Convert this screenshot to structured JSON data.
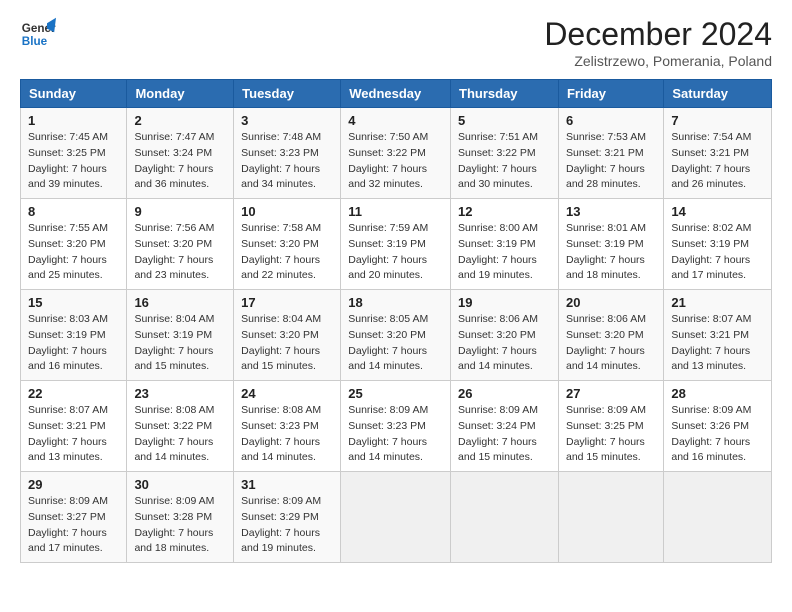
{
  "logo": {
    "line1": "General",
    "line2": "Blue"
  },
  "title": "December 2024",
  "location": "Zelistrzewo, Pomerania, Poland",
  "days_of_week": [
    "Sunday",
    "Monday",
    "Tuesday",
    "Wednesday",
    "Thursday",
    "Friday",
    "Saturday"
  ],
  "weeks": [
    [
      {
        "day": "1",
        "info": "Sunrise: 7:45 AM\nSunset: 3:25 PM\nDaylight: 7 hours\nand 39 minutes."
      },
      {
        "day": "2",
        "info": "Sunrise: 7:47 AM\nSunset: 3:24 PM\nDaylight: 7 hours\nand 36 minutes."
      },
      {
        "day": "3",
        "info": "Sunrise: 7:48 AM\nSunset: 3:23 PM\nDaylight: 7 hours\nand 34 minutes."
      },
      {
        "day": "4",
        "info": "Sunrise: 7:50 AM\nSunset: 3:22 PM\nDaylight: 7 hours\nand 32 minutes."
      },
      {
        "day": "5",
        "info": "Sunrise: 7:51 AM\nSunset: 3:22 PM\nDaylight: 7 hours\nand 30 minutes."
      },
      {
        "day": "6",
        "info": "Sunrise: 7:53 AM\nSunset: 3:21 PM\nDaylight: 7 hours\nand 28 minutes."
      },
      {
        "day": "7",
        "info": "Sunrise: 7:54 AM\nSunset: 3:21 PM\nDaylight: 7 hours\nand 26 minutes."
      }
    ],
    [
      {
        "day": "8",
        "info": "Sunrise: 7:55 AM\nSunset: 3:20 PM\nDaylight: 7 hours\nand 25 minutes."
      },
      {
        "day": "9",
        "info": "Sunrise: 7:56 AM\nSunset: 3:20 PM\nDaylight: 7 hours\nand 23 minutes."
      },
      {
        "day": "10",
        "info": "Sunrise: 7:58 AM\nSunset: 3:20 PM\nDaylight: 7 hours\nand 22 minutes."
      },
      {
        "day": "11",
        "info": "Sunrise: 7:59 AM\nSunset: 3:19 PM\nDaylight: 7 hours\nand 20 minutes."
      },
      {
        "day": "12",
        "info": "Sunrise: 8:00 AM\nSunset: 3:19 PM\nDaylight: 7 hours\nand 19 minutes."
      },
      {
        "day": "13",
        "info": "Sunrise: 8:01 AM\nSunset: 3:19 PM\nDaylight: 7 hours\nand 18 minutes."
      },
      {
        "day": "14",
        "info": "Sunrise: 8:02 AM\nSunset: 3:19 PM\nDaylight: 7 hours\nand 17 minutes."
      }
    ],
    [
      {
        "day": "15",
        "info": "Sunrise: 8:03 AM\nSunset: 3:19 PM\nDaylight: 7 hours\nand 16 minutes."
      },
      {
        "day": "16",
        "info": "Sunrise: 8:04 AM\nSunset: 3:19 PM\nDaylight: 7 hours\nand 15 minutes."
      },
      {
        "day": "17",
        "info": "Sunrise: 8:04 AM\nSunset: 3:20 PM\nDaylight: 7 hours\nand 15 minutes."
      },
      {
        "day": "18",
        "info": "Sunrise: 8:05 AM\nSunset: 3:20 PM\nDaylight: 7 hours\nand 14 minutes."
      },
      {
        "day": "19",
        "info": "Sunrise: 8:06 AM\nSunset: 3:20 PM\nDaylight: 7 hours\nand 14 minutes."
      },
      {
        "day": "20",
        "info": "Sunrise: 8:06 AM\nSunset: 3:20 PM\nDaylight: 7 hours\nand 14 minutes."
      },
      {
        "day": "21",
        "info": "Sunrise: 8:07 AM\nSunset: 3:21 PM\nDaylight: 7 hours\nand 13 minutes."
      }
    ],
    [
      {
        "day": "22",
        "info": "Sunrise: 8:07 AM\nSunset: 3:21 PM\nDaylight: 7 hours\nand 13 minutes."
      },
      {
        "day": "23",
        "info": "Sunrise: 8:08 AM\nSunset: 3:22 PM\nDaylight: 7 hours\nand 14 minutes."
      },
      {
        "day": "24",
        "info": "Sunrise: 8:08 AM\nSunset: 3:23 PM\nDaylight: 7 hours\nand 14 minutes."
      },
      {
        "day": "25",
        "info": "Sunrise: 8:09 AM\nSunset: 3:23 PM\nDaylight: 7 hours\nand 14 minutes."
      },
      {
        "day": "26",
        "info": "Sunrise: 8:09 AM\nSunset: 3:24 PM\nDaylight: 7 hours\nand 15 minutes."
      },
      {
        "day": "27",
        "info": "Sunrise: 8:09 AM\nSunset: 3:25 PM\nDaylight: 7 hours\nand 15 minutes."
      },
      {
        "day": "28",
        "info": "Sunrise: 8:09 AM\nSunset: 3:26 PM\nDaylight: 7 hours\nand 16 minutes."
      }
    ],
    [
      {
        "day": "29",
        "info": "Sunrise: 8:09 AM\nSunset: 3:27 PM\nDaylight: 7 hours\nand 17 minutes."
      },
      {
        "day": "30",
        "info": "Sunrise: 8:09 AM\nSunset: 3:28 PM\nDaylight: 7 hours\nand 18 minutes."
      },
      {
        "day": "31",
        "info": "Sunrise: 8:09 AM\nSunset: 3:29 PM\nDaylight: 7 hours\nand 19 minutes."
      },
      null,
      null,
      null,
      null
    ]
  ]
}
